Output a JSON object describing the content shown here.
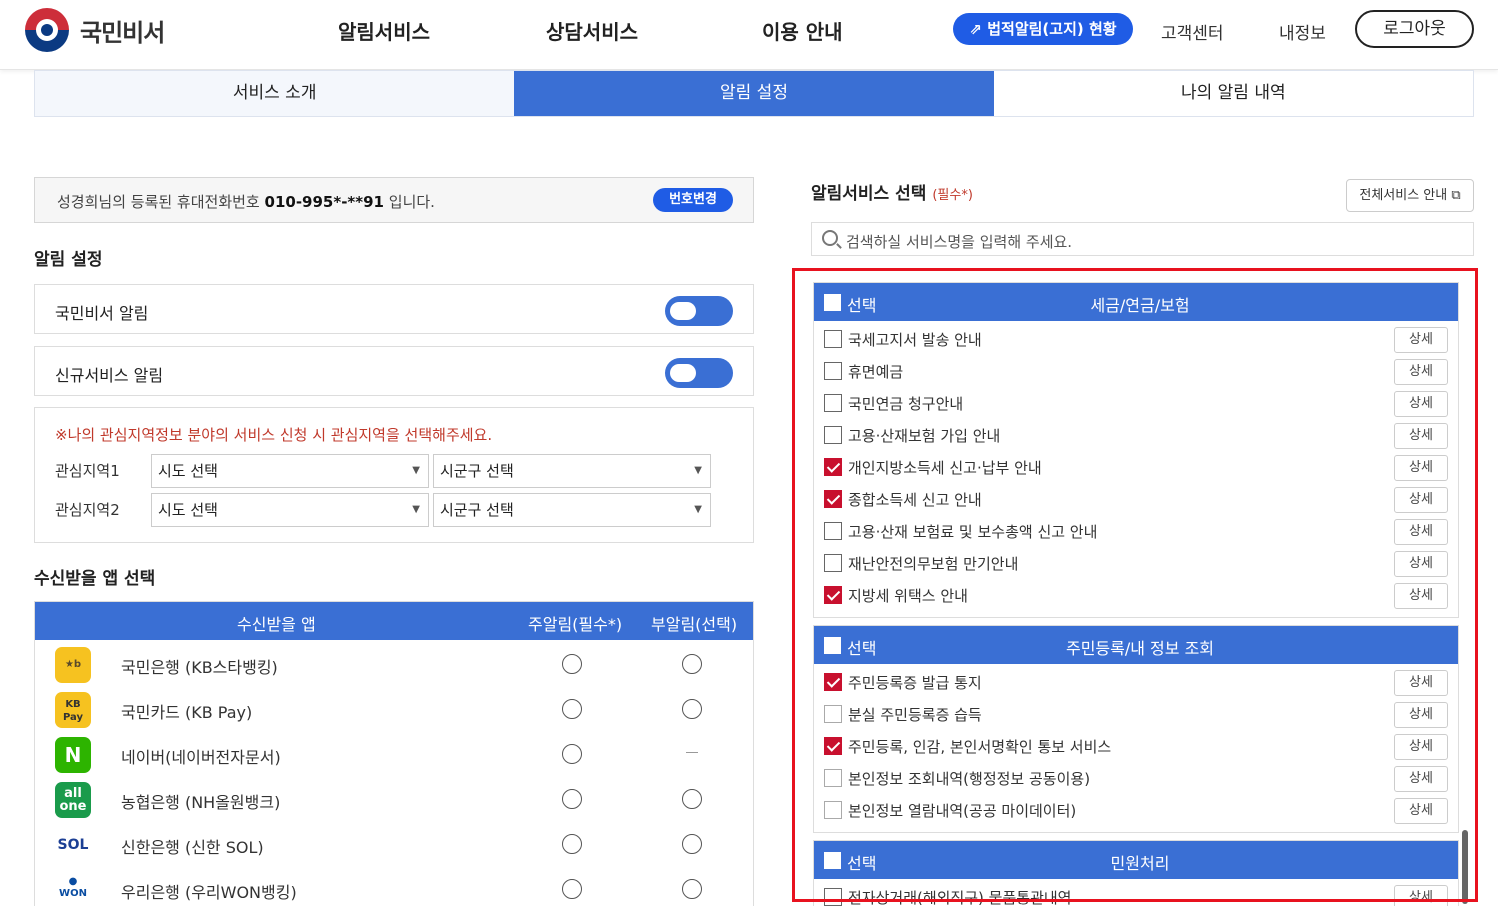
{
  "header": {
    "logo_text": "국민비서",
    "nav": [
      "알림서비스",
      "상담서비스",
      "이용 안내"
    ],
    "legal_button": "⇗ 법적알림(고지) 현황",
    "util": [
      "고객센터",
      "내정보"
    ],
    "logout": "로그아웃"
  },
  "tabs": [
    "서비스 소개",
    "알림 설정",
    "나의 알림 내역"
  ],
  "phone": {
    "prefix": "성경희님의 등록된 휴대전화번호 ",
    "number": "010-995*-**91",
    "suffix": " 입니다.",
    "change_button": "번호변경"
  },
  "alarm_setting": {
    "title": "알림 설정",
    "toggles": [
      {
        "label": "국민비서 알림",
        "on": true
      },
      {
        "label": "신규서비스 알림",
        "on": true
      }
    ]
  },
  "region": {
    "note": "※나의 관심지역정보 분야의 서비스 신청 시 관심지역을 선택해주세요.",
    "rows": [
      {
        "label": "관심지역1",
        "sido": "시도 선택",
        "sigungu": "시군구 선택"
      },
      {
        "label": "관심지역2",
        "sido": "시도 선택",
        "sigungu": "시군구 선택"
      }
    ]
  },
  "apps": {
    "title": "수신받을 앱 선택",
    "headers": [
      "수신받을 앱",
      "주알림(필수*)",
      "부알림(선택)"
    ],
    "rows": [
      {
        "name": "국민은행 (KB스타뱅킹)",
        "icon": "kb-star-icon",
        "sub": true
      },
      {
        "name": "국민카드 (KB Pay)",
        "icon": "kb-pay-icon",
        "sub": true
      },
      {
        "name": "네이버(네이버전자문서)",
        "icon": "naver-icon",
        "sub": false
      },
      {
        "name": "농협은행 (NH올원뱅크)",
        "icon": "nh-allone-icon",
        "sub": true
      },
      {
        "name": "신한은행 (신한 SOL)",
        "icon": "shinhan-sol-icon",
        "sub": true
      },
      {
        "name": "우리은행 (우리WON뱅킹)",
        "icon": "woori-won-icon",
        "sub": true
      }
    ]
  },
  "services": {
    "title": "알림서비스 선택",
    "required": "(필수*)",
    "all_button": "전체서비스 안내 ⧉",
    "search_placeholder": "검색하실 서비스명을 입력해 주세요.",
    "select_label": "선택",
    "detail_label": "상세",
    "groups": [
      {
        "title": "세금/연금/보험",
        "items": [
          {
            "name": "국세고지서 발송 안내",
            "checked": false
          },
          {
            "name": "휴면예금",
            "checked": false
          },
          {
            "name": "국민연금 청구안내",
            "checked": false
          },
          {
            "name": "고용·산재보험 가입 안내",
            "checked": false
          },
          {
            "name": "개인지방소득세 신고·납부 안내",
            "checked": true
          },
          {
            "name": "종합소득세 신고 안내",
            "checked": true
          },
          {
            "name": "고용·산재 보험료 및 보수총액 신고 안내",
            "checked": false
          },
          {
            "name": "재난안전의무보험 만기안내",
            "checked": false
          },
          {
            "name": "지방세 위택스 안내",
            "checked": true
          }
        ]
      },
      {
        "title": "주민등록/내 정보 조회",
        "items": [
          {
            "name": "주민등록증 발급 통지",
            "checked": true
          },
          {
            "name": "분실 주민등록증 습득",
            "checked": false
          },
          {
            "name": "주민등록, 인감, 본인서명확인 통보 서비스",
            "checked": true
          },
          {
            "name": "본인정보 조회내역(행정정보 공동이용)",
            "checked": false
          },
          {
            "name": "본인정보 열람내역(공공 마이데이터)",
            "checked": false
          }
        ]
      },
      {
        "title": "민원처리",
        "items": [
          {
            "name": "전자상거래(해외직구) 물품통관내역",
            "checked": false
          }
        ]
      }
    ]
  }
}
